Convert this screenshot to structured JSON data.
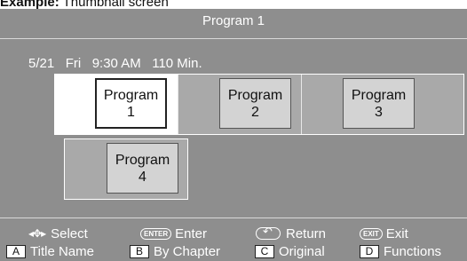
{
  "caption": {
    "prefix": "Example:",
    "text": "Thumbnail screen"
  },
  "screen": {
    "title": "Program 1",
    "info": "5/21   Fri   9:30 AM   110 Min."
  },
  "thumbnails": [
    {
      "label1": "Program",
      "label2": "1",
      "selected": true
    },
    {
      "label1": "Program",
      "label2": "2",
      "selected": false
    },
    {
      "label1": "Program",
      "label2": "3",
      "selected": false
    },
    {
      "label1": "Program",
      "label2": "4",
      "selected": false
    }
  ],
  "help": {
    "select": {
      "icon": "up-down-left-right-arrows-icon",
      "glyph": "◂✥▸",
      "label": "Select"
    },
    "enter": {
      "icon": "enter-button-icon",
      "key": "ENTER",
      "label": "Enter"
    },
    "return": {
      "icon": "return-button-icon",
      "label": "Return"
    },
    "exit": {
      "icon": "exit-button-icon",
      "key": "EXIT",
      "label": "Exit"
    },
    "a": {
      "key": "A",
      "label": "Title Name"
    },
    "b": {
      "key": "B",
      "label": "By Chapter"
    },
    "c": {
      "key": "C",
      "label": "Original"
    },
    "d": {
      "key": "D",
      "label": "Functions"
    }
  },
  "colors": {
    "background": "#8e8e8e",
    "selected": "#ffffff",
    "unselected": "#d3d3d3"
  }
}
